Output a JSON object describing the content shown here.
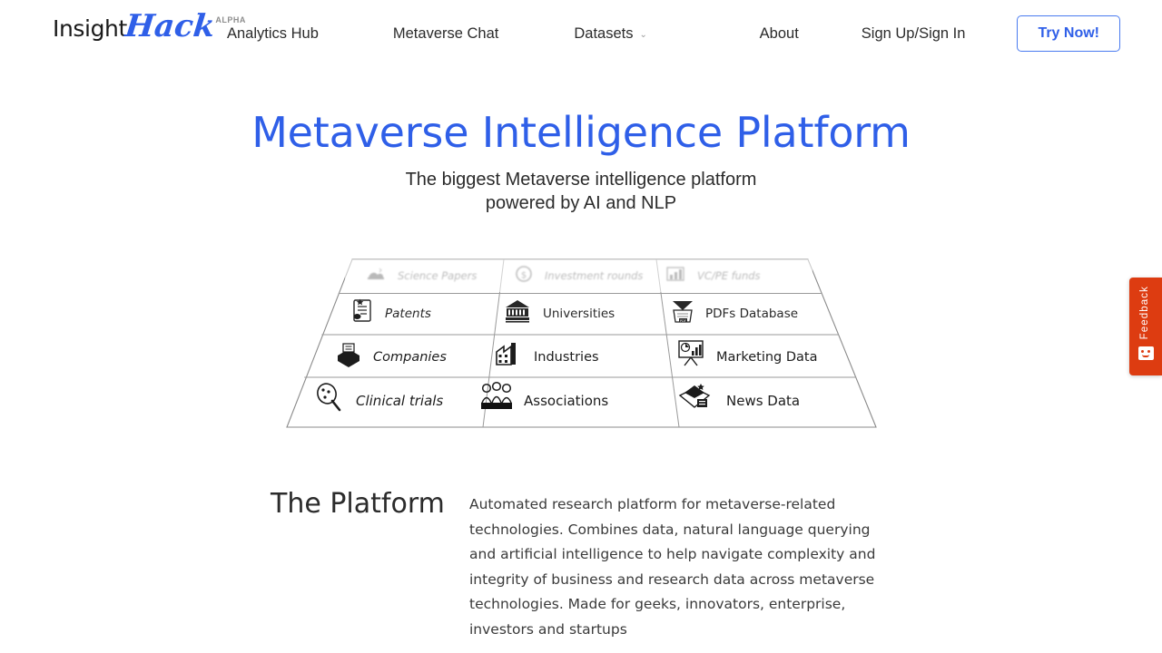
{
  "brand": {
    "name_part1": "Insight",
    "name_part2": "Hack",
    "tag": "ALPHA"
  },
  "nav": {
    "left_items": [
      {
        "label": "Analytics Hub",
        "name": "nav-analytics-hub",
        "has_caret": false
      },
      {
        "label": "Metaverse Chat",
        "name": "nav-metaverse-chat",
        "has_caret": false
      },
      {
        "label": "Datasets",
        "name": "nav-datasets",
        "has_caret": true
      }
    ],
    "caret_glyph": "⌄",
    "about_label": "About",
    "signin_label": "Sign Up/Sign In",
    "cta_label": "Try Now!",
    "accent_color": "#2f5fe8",
    "cta_border_color": "#4a7bf0"
  },
  "hero": {
    "title": "Metaverse Intelligence Platform",
    "subtitle_line1": "The biggest Metaverse intelligence platform",
    "subtitle_line2": "powered by AI and NLP",
    "title_color": "#2f5fe8"
  },
  "grid": {
    "rows": [
      {
        "row_index": 0,
        "faded": true,
        "cells": [
          {
            "label": "Science Papers",
            "icon": "science-papers-icon"
          },
          {
            "label": "Investment rounds",
            "icon": "investment-rounds-icon"
          },
          {
            "label": "VC/PE funds",
            "icon": "vc-pe-funds-icon"
          }
        ]
      },
      {
        "row_index": 1,
        "faded": false,
        "cells": [
          {
            "label": "Patents",
            "icon": "patents-icon"
          },
          {
            "label": "Universities",
            "icon": "universities-icon"
          },
          {
            "label": "PDFs Database",
            "icon": "pdfs-database-icon"
          }
        ]
      },
      {
        "row_index": 2,
        "faded": false,
        "cells": [
          {
            "label": "Companies",
            "icon": "companies-icon"
          },
          {
            "label": "Industries",
            "icon": "industries-icon"
          },
          {
            "label": "Marketing Data",
            "icon": "marketing-data-icon"
          }
        ]
      },
      {
        "row_index": 3,
        "faded": false,
        "cells": [
          {
            "label": "Clinical trials",
            "icon": "clinical-trials-icon"
          },
          {
            "label": "Associations",
            "icon": "associations-icon"
          },
          {
            "label": "News Data",
            "icon": "news-data-icon"
          }
        ]
      }
    ]
  },
  "platform": {
    "heading": "The Platform",
    "body": "Automated research platform for metaverse-related technologies. Combines data, natural language querying and artificial intelligence to help navigate complexity and integrity of business and research data across metaverse technologies. Made for geeks, innovators, enterprise, investors and startups"
  },
  "feedback": {
    "label": "Feedback",
    "color": "#dd3c11"
  }
}
